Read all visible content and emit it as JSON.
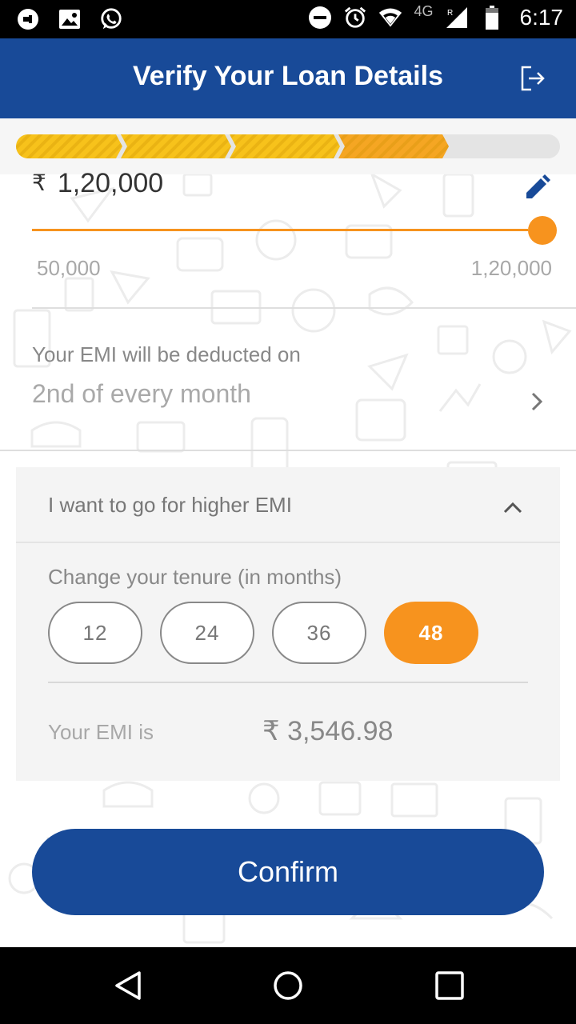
{
  "status_bar": {
    "time": "6:17",
    "network": "4G",
    "left_icons": [
      "notification-dot-icon",
      "image-icon",
      "whatsapp-icon"
    ],
    "right_icons": [
      "do-not-disturb-icon",
      "alarm-icon",
      "wifi-icon",
      "signal-icon",
      "battery-icon"
    ]
  },
  "header": {
    "title": "Verify Your Loan Details",
    "exit_icon": "exit-icon"
  },
  "progress": {
    "total_steps": 5,
    "completed_steps": 4,
    "colors": {
      "done": "#f7c21b",
      "current": "#f5a623",
      "pending": "#e4e4e4"
    }
  },
  "loan_amount": {
    "currency": "₹",
    "value": "1,20,000",
    "min_label": "50,000",
    "max_label": "1,20,000",
    "slider_fraction": 1.0,
    "edit_icon": "pencil-icon"
  },
  "emi_date": {
    "label": "Your EMI will be deducted on",
    "value": "2nd of every month"
  },
  "higher_emi": {
    "title": "I want to go for higher EMI",
    "expanded": true,
    "tenure_label": "Change your tenure (in months)",
    "tenures": [
      "12",
      "24",
      "36",
      "48"
    ],
    "selected_tenure": "48",
    "emi_label": "Your EMI is",
    "emi_value": "₹ 3,546.98"
  },
  "confirm_button": {
    "label": "Confirm"
  },
  "colors": {
    "primary": "#184a98",
    "accent": "#f7931e",
    "status_bar": "#000000"
  },
  "nav_bar": {
    "buttons": [
      "back-icon",
      "home-icon",
      "recents-icon"
    ]
  }
}
